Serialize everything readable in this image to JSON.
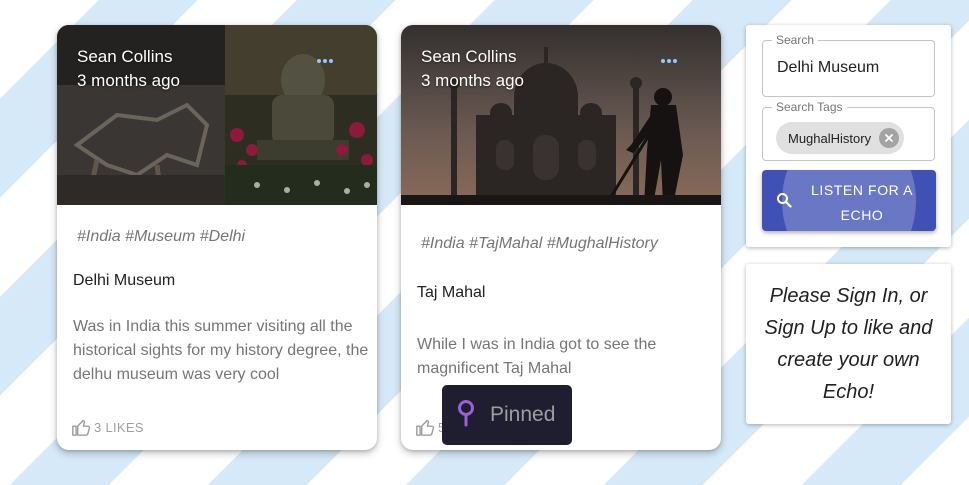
{
  "cards": [
    {
      "author": "Sean Collins",
      "time": "3 months ago",
      "tags": "#India #Museum #Delhi",
      "title": "Delhi Museum",
      "description": "Was in India this summer visiting all the historical sights for my history degree, the delhu museum was very cool",
      "likes": "3 LIKES"
    },
    {
      "author": "Sean Collins",
      "time": "3 months ago",
      "tags": "#India #TajMahal #MughalHistory",
      "title": "Taj Mahal",
      "description": "While I was in India got to see the magnificent Taj Mahal",
      "likes": "5"
    }
  ],
  "search": {
    "label": "Search",
    "value": "Delhi Museum",
    "tags_label": "Search Tags",
    "tag_chip": "MughalHistory",
    "button_label": "LISTEN FOR A ECHO"
  },
  "signin": {
    "message": "Please Sign In, or Sign Up to like and create your own Echo!"
  },
  "toast": {
    "label": "Pinned"
  },
  "colors": {
    "primary": "#3f51b5",
    "stripe": "#d6e9f8",
    "toast_bg": "#1e1e30",
    "pin": "#9c5fd6"
  }
}
